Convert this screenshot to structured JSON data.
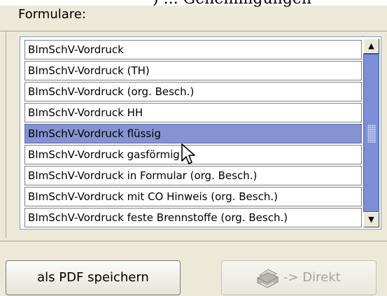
{
  "top_fragment": ") ... Genehmigungen",
  "group": {
    "label": "Formulare:"
  },
  "list": {
    "items": [
      "BImSchV-Vordruck",
      "BImSchV-Vordruck (TH)",
      "BImSchV-Vordruck (org. Besch.)",
      "BImSchV-Vordruck HH",
      "BImSchV-Vordruck flüssig",
      "BImSchV-Vordruck gasförmig",
      "BImSchV-Vordruck in Formular (org. Besch.)",
      "BImSchV-Vordruck mit CO Hinweis (org. Besch.)",
      "BImSchV-Vordruck feste Brennstoffe (org. Besch.)"
    ],
    "selected_index": 4
  },
  "scrollbar": {
    "up_glyph": "▲",
    "down_glyph": "▼"
  },
  "buttons": {
    "pdf_label": "als PDF speichern",
    "direct_label": "-> Direkt"
  },
  "icons": {
    "printer": "printer-icon",
    "cursor": "mouse-cursor-icon"
  },
  "colors": {
    "selected_row": "#8593d1",
    "scroll_thumb": "#7b8ed6"
  }
}
